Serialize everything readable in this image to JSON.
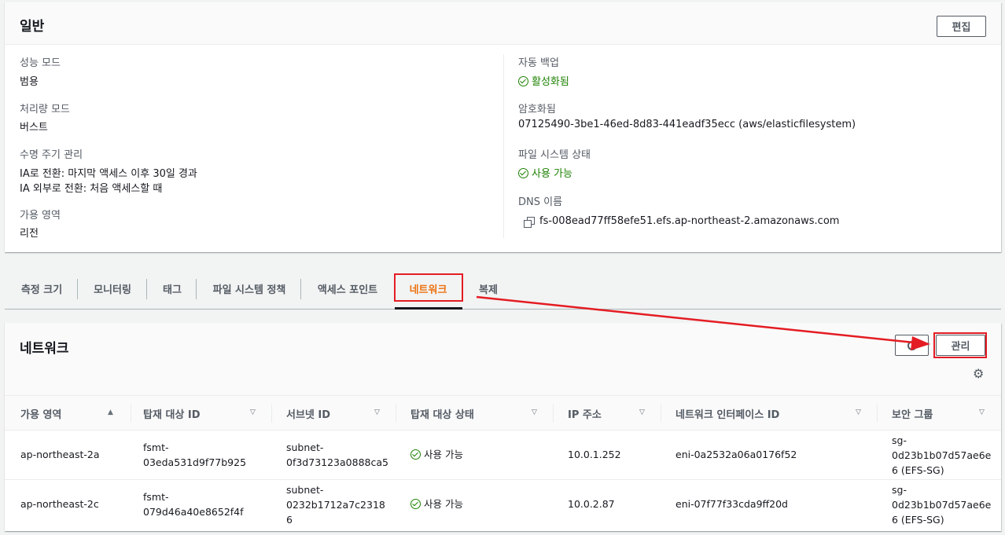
{
  "general": {
    "title": "일반",
    "edit_label": "편집",
    "left": [
      {
        "label": "성능 모드",
        "value": "범용"
      },
      {
        "label": "처리량 모드",
        "value": "버스트"
      },
      {
        "label": "수명 주기 관리",
        "value1": "IA로 전환: 마지막 액세스 이후 30일 경과",
        "value2": "IA 외부로 전환: 처음 액세스할 때"
      },
      {
        "label": "가용 영역",
        "value": "리전"
      }
    ],
    "right": [
      {
        "label": "자동 백업",
        "value": "활성화됨"
      },
      {
        "label": "암호화됨",
        "value": "07125490-3be1-46ed-8d83-441eadf35ecc (aws/elasticfilesystem)"
      },
      {
        "label": "파일 시스템 상태",
        "value": "사용 가능"
      },
      {
        "label": "DNS 이름",
        "value": "fs-008ead77ff58efe51.efs.ap-northeast-2.amazonaws.com"
      }
    ]
  },
  "tabs": [
    "측정 크기",
    "모니터링",
    "태그",
    "파일 시스템 정책",
    "액세스 포인트",
    "네트워크",
    "복제"
  ],
  "network": {
    "title": "네트워크",
    "manage_label": "관리",
    "columns": [
      "가용 영역",
      "탑재 대상 ID",
      "서브넷 ID",
      "탑재 대상 상태",
      "IP 주소",
      "네트워크 인터페이스 ID",
      "보안 그룹"
    ],
    "rows": [
      {
        "az": "ap-northeast-2a",
        "mount_id_1": "fsmt-",
        "mount_id_2": "03eda531d9f77b925",
        "subnet_1": "subnet-",
        "subnet_2": "0f3d73123a0888ca5",
        "subnet_3": "",
        "status": "사용 가능",
        "ip": "10.0.1.252",
        "eni": "eni-0a2532a06a0176f52",
        "sg_1": "sg-",
        "sg_2": "0d23b1b07d57ae6e",
        "sg_3": "6 (EFS-SG)"
      },
      {
        "az": "ap-northeast-2c",
        "mount_id_1": "fsmt-",
        "mount_id_2": "079d46a40e8652f4f",
        "subnet_1": "subnet-",
        "subnet_2": "0232b1712a7c2318",
        "subnet_3": "6",
        "status": "사용 가능",
        "ip": "10.0.2.87",
        "eni": "eni-07f77f33cda9ff20d",
        "sg_1": "sg-",
        "sg_2": "0d23b1b07d57ae6e",
        "sg_3": "6 (EFS-SG)"
      }
    ]
  }
}
